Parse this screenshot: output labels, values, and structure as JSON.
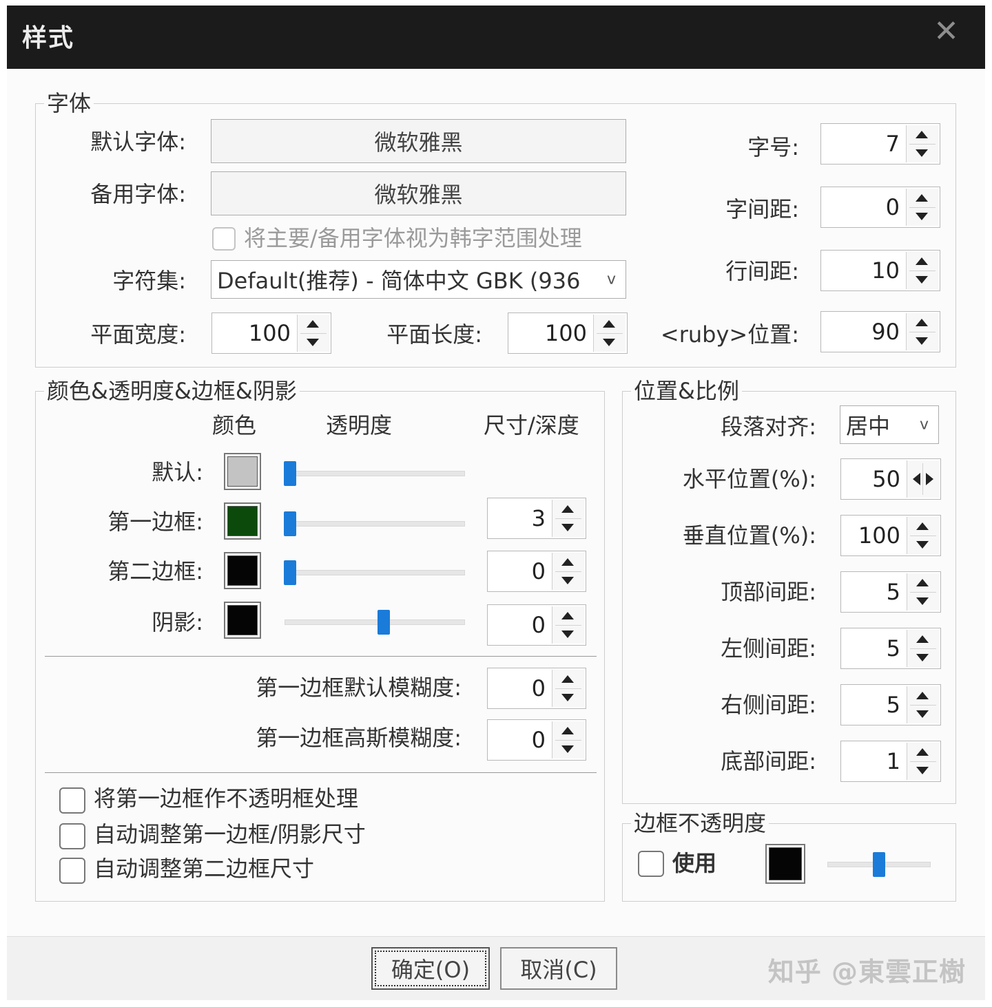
{
  "dialog": {
    "title": "样式",
    "close_icon": "✕"
  },
  "font_group": {
    "legend": "字体",
    "default_font_label": "默认字体:",
    "default_font_value": "微软雅黑",
    "backup_font_label": "备用字体:",
    "backup_font_value": "微软雅黑",
    "korean_range_label": "将主要/备用字体视为韩字范围处理",
    "charset_label": "字符集:",
    "charset_value": "Default(推荐) - 简体中文 GBK (936",
    "charset_arrow": "v",
    "plane_width_label": "平面宽度:",
    "plane_width_value": "100",
    "plane_length_label": "平面长度:",
    "plane_length_value": "100",
    "font_size_label": "字号:",
    "font_size_value": "7",
    "char_spacing_label": "字间距:",
    "char_spacing_value": "0",
    "line_spacing_label": "行间距:",
    "line_spacing_value": "10",
    "ruby_position_label": "<ruby>位置:",
    "ruby_position_value": "90"
  },
  "color_group": {
    "legend": "颜色&透明度&边框&阴影",
    "col_color": "颜色",
    "col_opacity": "透明度",
    "col_size": "尺寸/深度",
    "rows": [
      {
        "label": "默认:",
        "color": "#c3c3c3",
        "opacity": 0.03,
        "size": null
      },
      {
        "label": "第一边框:",
        "color": "#0b4a0b",
        "opacity": 0.03,
        "size": "3"
      },
      {
        "label": "第二边框:",
        "color": "#050505",
        "opacity": 0.03,
        "size": "0"
      },
      {
        "label": "阴影:",
        "color": "#050505",
        "opacity": 0.55,
        "size": "0"
      }
    ],
    "default_blur_label": "第一边框默认模糊度:",
    "default_blur_value": "0",
    "gauss_blur_label": "第一边框高斯模糊度:",
    "gauss_blur_value": "0",
    "check_opaque": "将第一边框作不透明框处理",
    "check_auto_border_shadow": "自动调整第一边框/阴影尺寸",
    "check_auto_second": "自动调整第二边框尺寸"
  },
  "position_group": {
    "legend": "位置&比例",
    "align_label": "段落对齐:",
    "align_value": "居中",
    "align_arrow": "v",
    "h_pos_label": "水平位置(%):",
    "h_pos_value": "50",
    "v_pos_label": "垂直位置(%):",
    "v_pos_value": "100",
    "top_margin_label": "顶部间距:",
    "top_margin_value": "5",
    "left_margin_label": "左侧间距:",
    "left_margin_value": "5",
    "right_margin_label": "右侧间距:",
    "right_margin_value": "5",
    "bottom_margin_label": "底部间距:",
    "bottom_margin_value": "1"
  },
  "border_opacity_group": {
    "legend": "边框不透明度",
    "use_label": "使用",
    "color": "#050505",
    "opacity": 0.5
  },
  "footer": {
    "ok_label": "确定(O)",
    "cancel_label": "取消(C)",
    "watermark": "知乎 @東雲正樹"
  }
}
